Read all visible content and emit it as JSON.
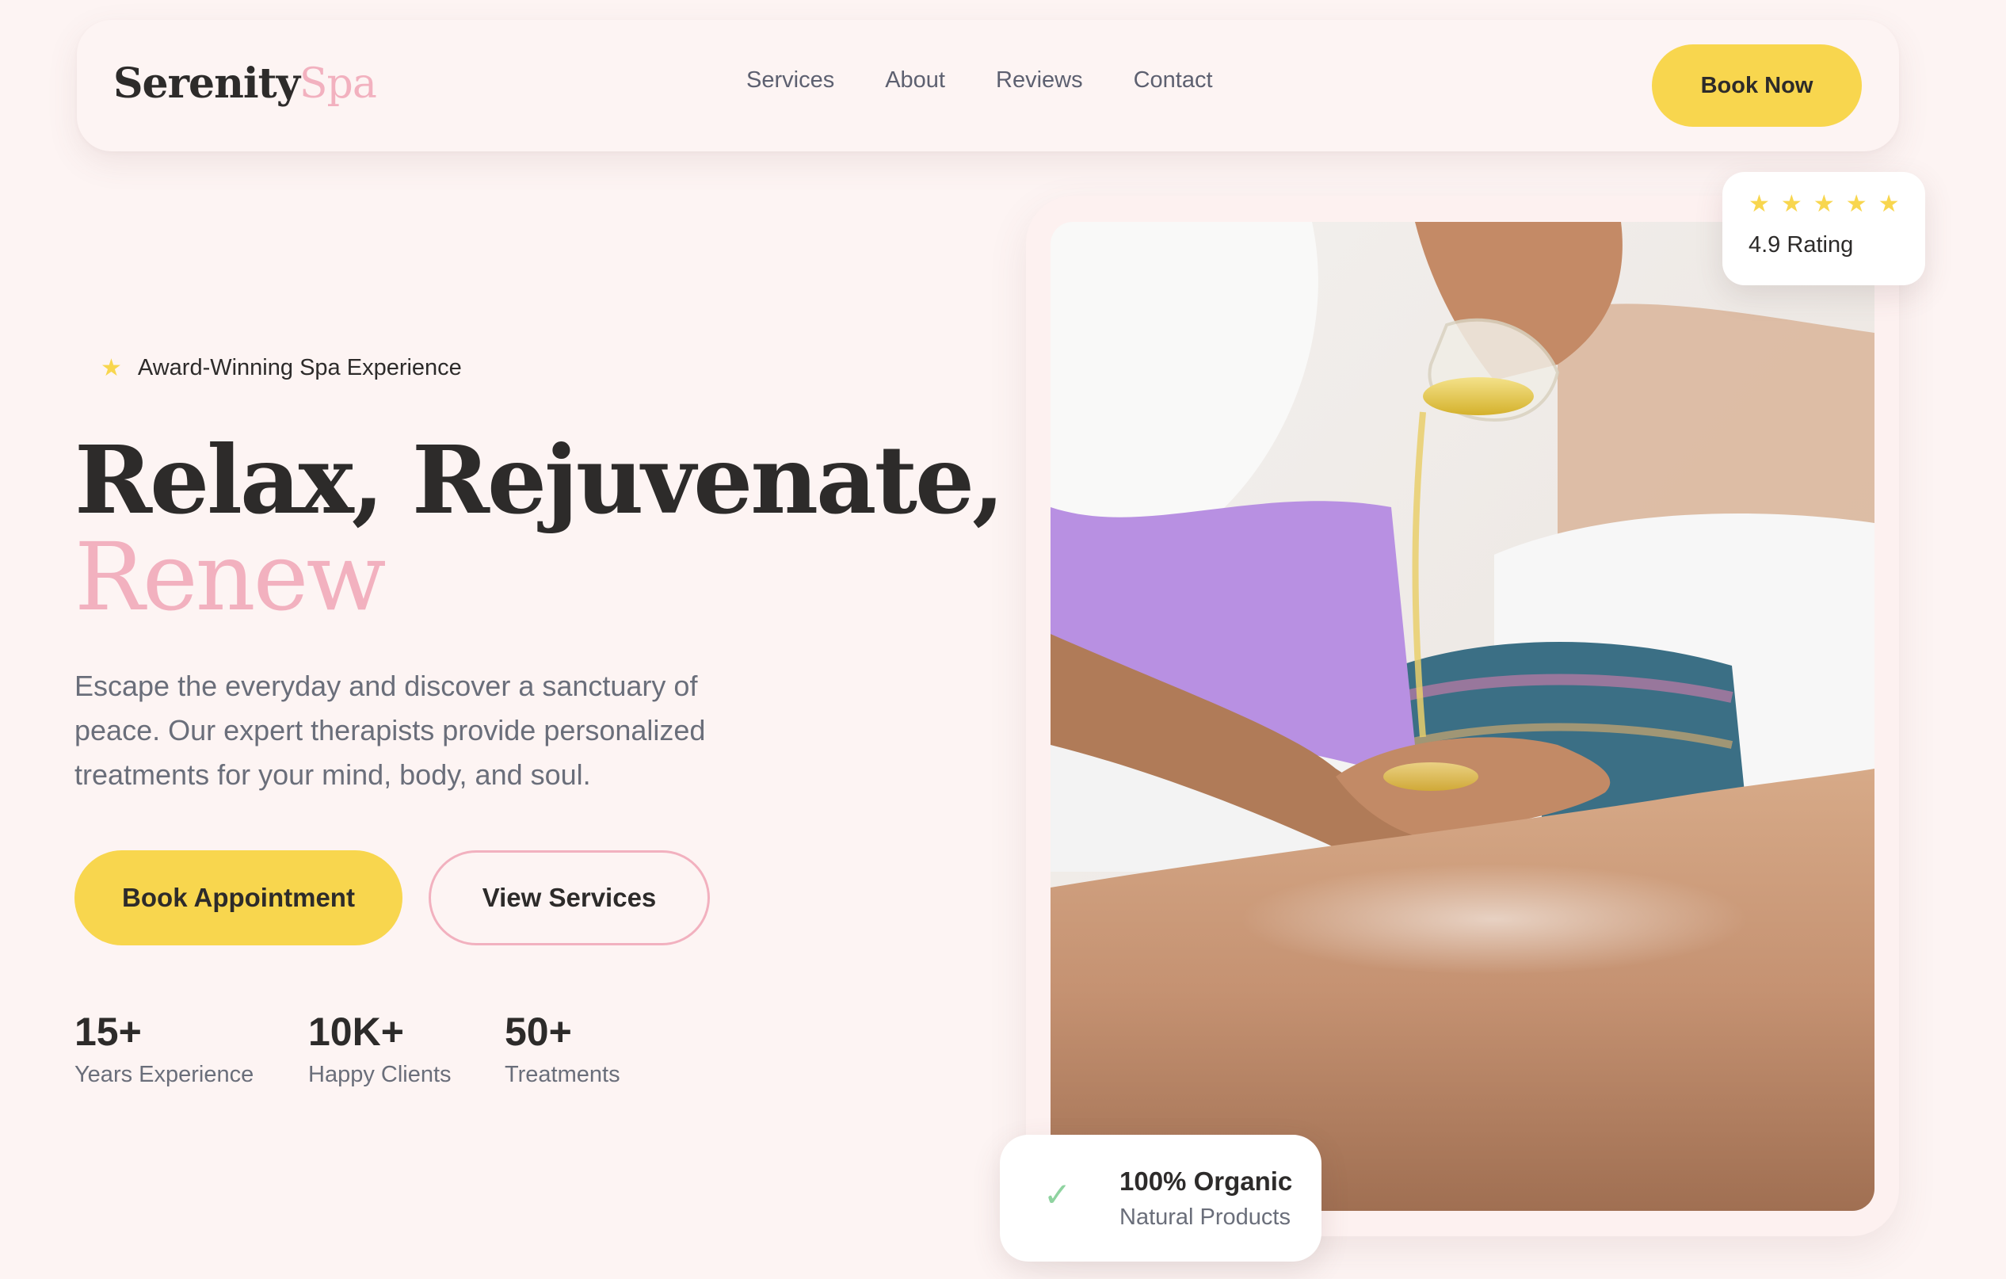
{
  "brand": {
    "name_main": "Serenity",
    "name_accent": "Spa"
  },
  "nav": {
    "links": [
      {
        "label": "Services"
      },
      {
        "label": "About"
      },
      {
        "label": "Reviews"
      },
      {
        "label": "Contact"
      }
    ],
    "cta_label": "Book Now"
  },
  "hero": {
    "badge_icon": "star-icon",
    "badge_text": "Award-Winning Spa Experience",
    "headline_line1": "Relax, Rejuvenate,",
    "headline_line2": "Renew",
    "lead": "Escape the everyday and discover a sanctuary of peace. Our expert therapists provide personalized treatments for your mind, body, and soul.",
    "primary_button": "Book Appointment",
    "secondary_button": "View Services",
    "stats": [
      {
        "value": "15+",
        "label": "Years Experience"
      },
      {
        "value": "10K+",
        "label": "Happy Clients"
      },
      {
        "value": "50+",
        "label": "Treatments"
      }
    ]
  },
  "rating_card": {
    "stars": 5,
    "text": "4.9 Rating"
  },
  "organic_card": {
    "icon": "check-icon",
    "title": "100% Organic",
    "subtitle": "Natural Products"
  },
  "colors": {
    "background": "#fdf4f3",
    "accent_yellow": "#f8d64e",
    "accent_pink": "#f2b1bf",
    "text_dark": "#2d2b2a",
    "text_muted": "#6a6e7a",
    "check_green": "#8fd3a0"
  }
}
